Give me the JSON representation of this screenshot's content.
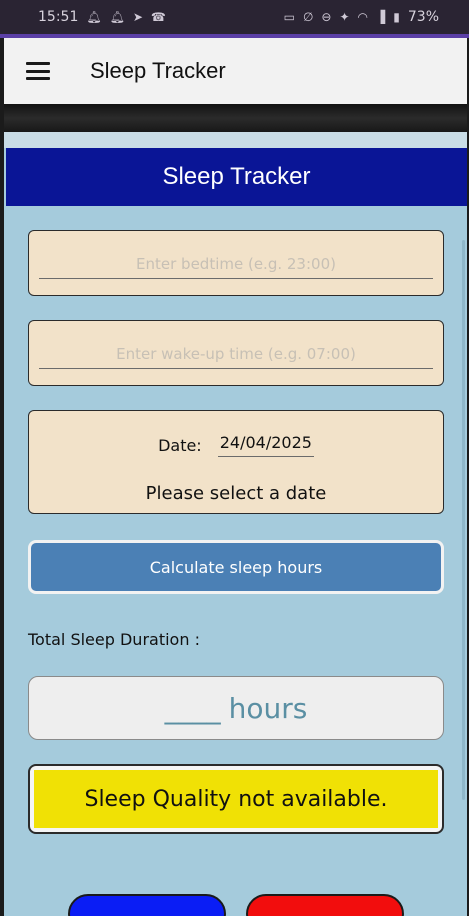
{
  "status_bar": {
    "time": "15:51",
    "battery": "73%",
    "left_icons": [
      "notification-icon",
      "notification-icon",
      "telegram-icon",
      "phone-icon"
    ],
    "right_icons": [
      "cast-icon",
      "mute-icon",
      "dnd-icon",
      "volte-icon",
      "wifi-icon",
      "signal-icon",
      "battery-icon"
    ]
  },
  "app_bar": {
    "title": "Sleep Tracker",
    "menu_icon": "hamburger-menu-icon"
  },
  "header": {
    "title": "Sleep Tracker"
  },
  "form": {
    "bedtime_placeholder": "Enter bedtime (e.g. 23:00)",
    "bedtime_value": "",
    "wakeup_placeholder": "Enter wake-up time (e.g. 07:00)",
    "wakeup_value": "",
    "date_label": "Date:",
    "date_value": "24/04/2025",
    "date_message": "Please select a date"
  },
  "calculate_button": {
    "label": "Calculate sleep hours"
  },
  "results": {
    "total_label": "Total Sleep Duration :",
    "hours_value": "____",
    "hours_unit": "hours",
    "quality_text": "Sleep Quality not available."
  },
  "colors": {
    "status_bar": "#2a2433",
    "header_banner": "#0a1596",
    "content_background": "#a5cbdc",
    "card_background": "#f2e2c9",
    "calculate_button": "#4b80b5",
    "quality_background": "#f0e105",
    "blue_button": "#0a1df5",
    "red_button": "#f20d0d"
  }
}
